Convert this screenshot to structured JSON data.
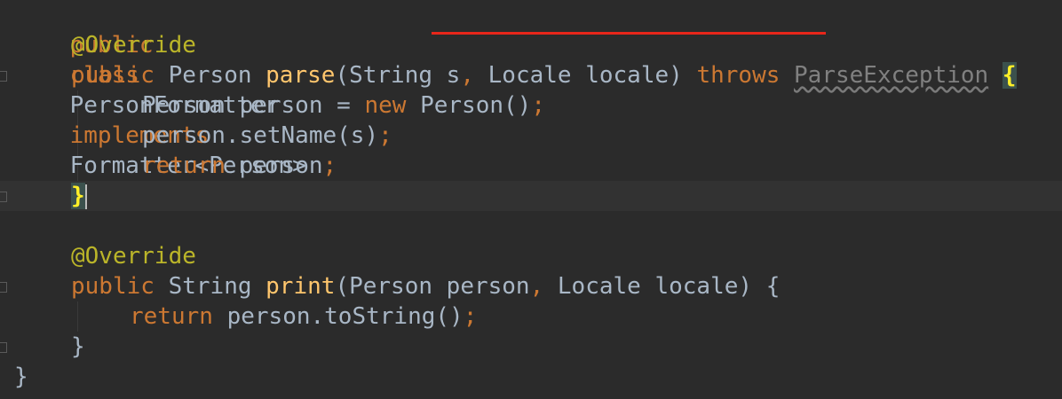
{
  "code": {
    "l1": {
      "kw_public": "public",
      "kw_class": "class",
      "class_name": "PersonFormatter",
      "kw_implements": "implements",
      "iface": "Formatter<Person>",
      "brace": "{"
    },
    "l2": {
      "annotation": "@Override"
    },
    "l3": {
      "kw_public": "public",
      "ret_type": "Person",
      "method": "parse",
      "params_open": "(String s",
      "comma": ",",
      "params_rest": " Locale locale)",
      "kw_throws": "throws",
      "exception": "ParseException",
      "brace": "{"
    },
    "l4": {
      "decl": "Person person = ",
      "kw_new": "new",
      "ctor": " Person()",
      "semi": ";"
    },
    "l5": {
      "stmt": "person.setName(s)",
      "semi": ";"
    },
    "l6": {
      "kw_return": "return",
      "expr": " person",
      "semi": ";"
    },
    "l7": {
      "brace": "}"
    },
    "l8": {
      "annotation": "@Override"
    },
    "l9": {
      "kw_public": "public",
      "ret_type": "String",
      "method": "print",
      "params_open": "(Person person",
      "comma": ",",
      "params_rest": " Locale locale) {"
    },
    "l10": {
      "kw_return": "return",
      "expr": " person.toString()",
      "semi": ";"
    },
    "l11": {
      "brace": "}"
    },
    "l12": {
      "brace": "}"
    }
  },
  "colors": {
    "background": "#2b2b2b",
    "keyword": "#cc7832",
    "annotation": "#bbb529",
    "method": "#ffc66d",
    "text": "#a9b7c6",
    "highlight_underline": "#e8261a"
  }
}
